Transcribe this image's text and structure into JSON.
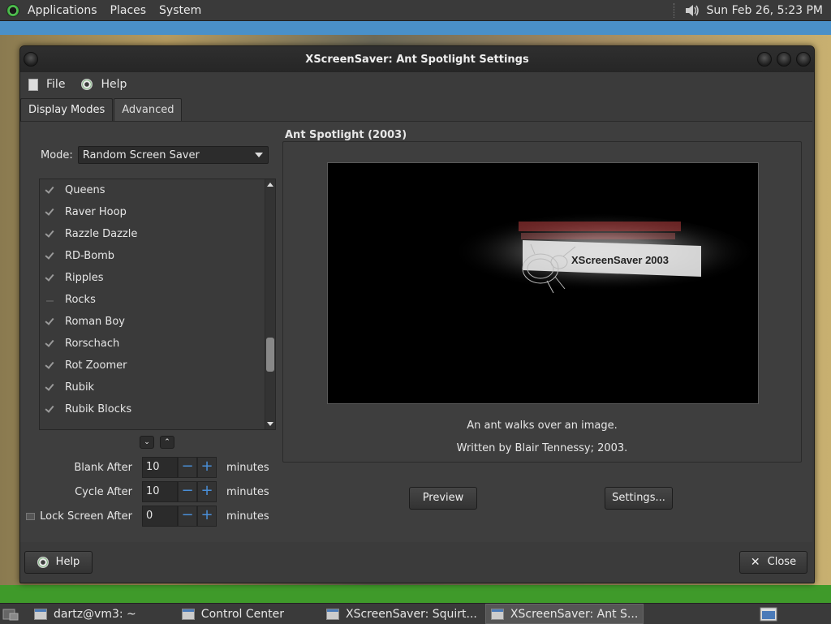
{
  "top_panel": {
    "menus": [
      "Applications",
      "Places",
      "System"
    ],
    "clock": "Sun Feb 26,  5:23 PM"
  },
  "window": {
    "title": "XScreenSaver: Ant Spotlight Settings",
    "menu": {
      "file": "File",
      "help": "Help"
    },
    "tabs": [
      "Display Modes",
      "Advanced"
    ],
    "mode": {
      "label": "Mode:",
      "value": "Random Screen Saver"
    },
    "hacks": [
      {
        "name": "Queens",
        "checked": true
      },
      {
        "name": "Raver Hoop",
        "checked": true
      },
      {
        "name": "Razzle Dazzle",
        "checked": true
      },
      {
        "name": "RD-Bomb",
        "checked": true
      },
      {
        "name": "Ripples",
        "checked": true
      },
      {
        "name": "Rocks",
        "checked": false
      },
      {
        "name": "Roman Boy",
        "checked": true
      },
      {
        "name": "Rorschach",
        "checked": true
      },
      {
        "name": "Rot Zoomer",
        "checked": true
      },
      {
        "name": "Rubik",
        "checked": true
      },
      {
        "name": "Rubik Blocks",
        "checked": true
      }
    ],
    "timing": {
      "blank": {
        "label": "Blank After",
        "value": "10",
        "unit": "minutes"
      },
      "cycle": {
        "label": "Cycle After",
        "value": "10",
        "unit": "minutes"
      },
      "lock": {
        "label": "Lock Screen After",
        "value": "0",
        "unit": "minutes",
        "checked": false
      }
    },
    "preview": {
      "title": "Ant Spotlight (2003)",
      "screen_text": "XScreenSaver 2003",
      "description": "An ant walks over an image.",
      "credit": "Written by Blair Tennessy; 2003.",
      "preview_button": "Preview",
      "settings_button": "Settings..."
    },
    "footer": {
      "help_button": "Help",
      "close_button": "Close"
    }
  },
  "taskbar": {
    "tasks": [
      "dartz@vm3: ~",
      "Control Center",
      "XScreenSaver: Squirt...",
      "XScreenSaver: Ant S..."
    ]
  }
}
